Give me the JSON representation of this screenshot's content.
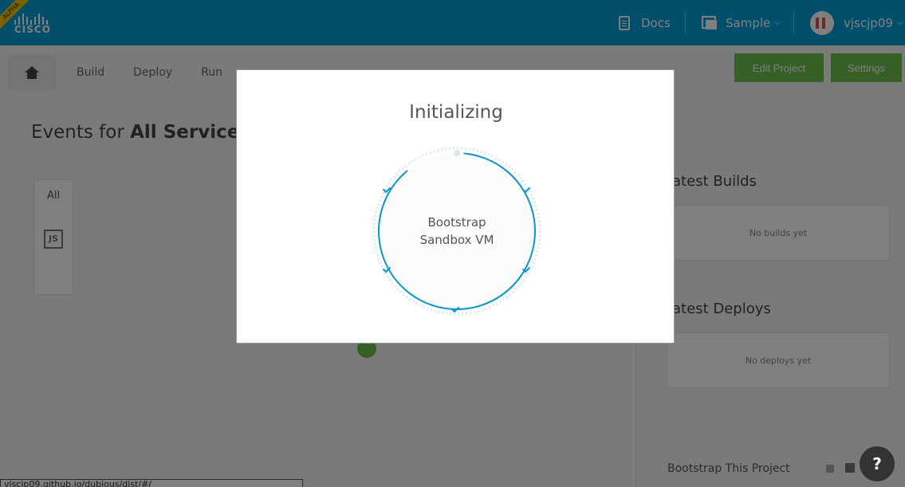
{
  "header": {
    "alpha_badge": "ALPHA",
    "logo_text": "CISCO",
    "docs_label": "Docs",
    "sample_label": "Sample",
    "user_label": "vjscjp09"
  },
  "subnav": {
    "tabs": [
      "Build",
      "Deploy",
      "Run"
    ],
    "edit_project": "Edit Project",
    "settings": "Settings"
  },
  "events": {
    "title_prefix": "Events for ",
    "title_bold": "All Services",
    "filter_all": "All",
    "filter_js": "JS"
  },
  "right": {
    "latest_builds": "Latest Builds",
    "no_builds": "No builds yet",
    "latest_deploys": "Latest Deploys",
    "no_deploys": "No deploys yet",
    "bootstrap_link": "Bootstrap This Project"
  },
  "status_url": "vjscjp09.github.io/dubious/dist/#/",
  "help_label": "?",
  "modal": {
    "title": "Initializing",
    "step_line1": "Bootstrap",
    "step_line2": "Sandbox VM"
  },
  "colors": {
    "brand": "#049fd9",
    "accent_green": "#6cc04a",
    "ring": "#0a95cc"
  }
}
